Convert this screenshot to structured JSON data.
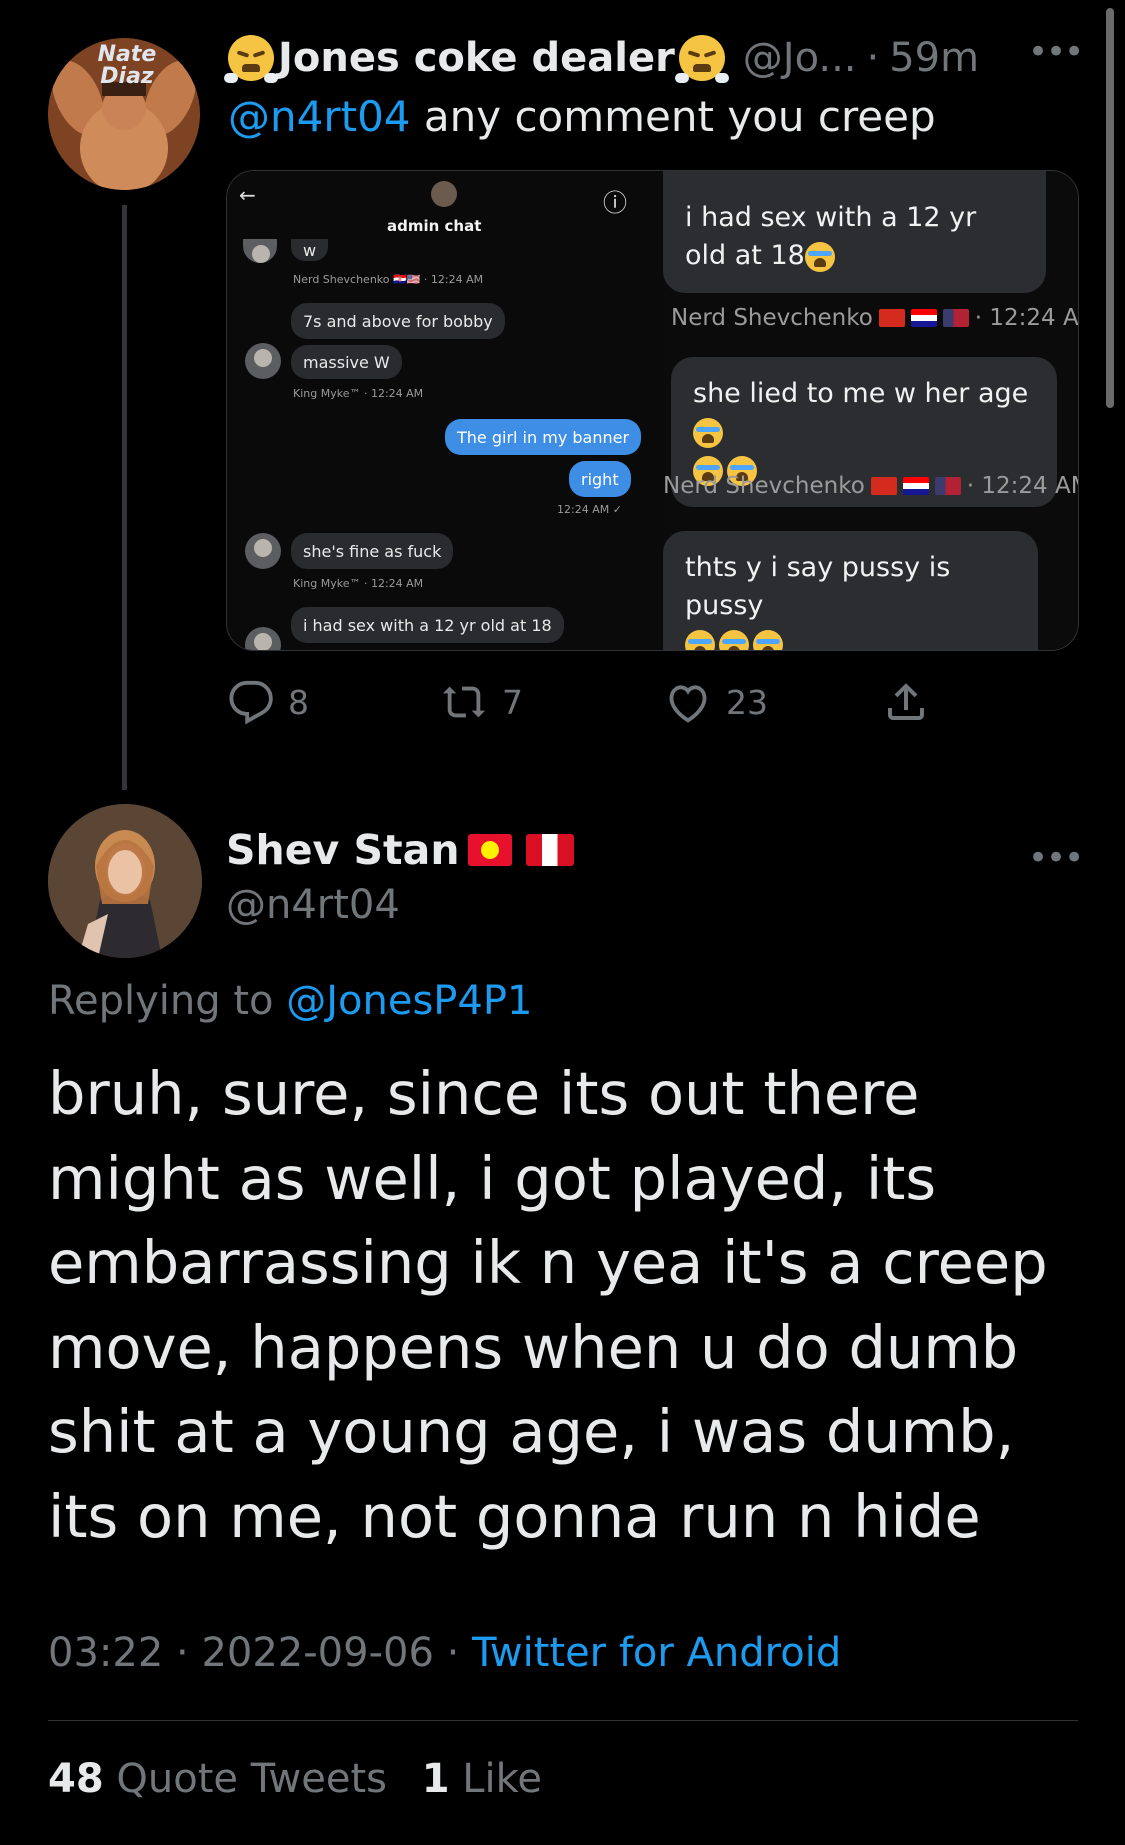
{
  "first_tweet": {
    "display_name": "Jones coke dealer",
    "handle": "@Jo...",
    "time": "59m",
    "separator": "·",
    "text_mention": "@n4rt04",
    "text_rest": " any comment you creep",
    "avatar_text": "Nate Diaz",
    "media": {
      "left_screenshot": {
        "back_icon": "←",
        "info_icon": "ⓘ",
        "header_title": "admin chat",
        "messages": [
          {
            "text": "w"
          },
          {
            "meta": "Nerd Shevchenko 🇭🇷🇺🇸 · 12:24 AM"
          },
          {
            "text": "7s and above for bobby"
          },
          {
            "text": "massive W"
          },
          {
            "meta": "King Myke™ · 12:24 AM"
          },
          {
            "text": "The girl in my banner"
          },
          {
            "text": "right"
          },
          {
            "meta": "12:24 AM ✓"
          },
          {
            "text": "she's fine as fuck"
          },
          {
            "meta": "King Myke™ · 12:24 AM"
          },
          {
            "text": "i had sex with a 12 yr old at 18"
          }
        ]
      },
      "right_screenshot": {
        "bubble1": "i had sex with a 12 yr old at 18",
        "meta1": "Nerd Shevchenko",
        "meta1_time": "· 12:24 AI",
        "bubble2": "she lied to me w her age",
        "meta2": "Nerd Shevchenko",
        "meta2_time": "· 12:24 AM",
        "bubble3": "thts y i say pussy is pussy"
      }
    },
    "actions": {
      "replies": "8",
      "retweets": "7",
      "likes": "23"
    }
  },
  "second_tweet": {
    "display_name": "Shev Stan",
    "handle": "@n4rt04",
    "replying_label": "Replying to ",
    "replying_handle": "@JonesP4P1",
    "body": "bruh, sure, since its out there might as well, i got played, its embarrassing ik n yea it's a creep move, happens when u do dumb shit at a young age, i was dumb, its on me, not gonna run n hide",
    "time": "03:22",
    "date": "2022-09-06",
    "sep": " · ",
    "source": "Twitter for Android",
    "quote_count": "48",
    "quote_label": " Quote Tweets",
    "like_count": "1",
    "like_label": " Like"
  },
  "icons": {
    "more": "•••",
    "reply": "reply-icon",
    "retweet": "retweet-icon",
    "like": "heart-icon",
    "share": "share-icon"
  },
  "colors": {
    "background": "#000000",
    "accent": "#1d9bf0",
    "muted": "#71767b",
    "text": "#e7e9ea"
  }
}
